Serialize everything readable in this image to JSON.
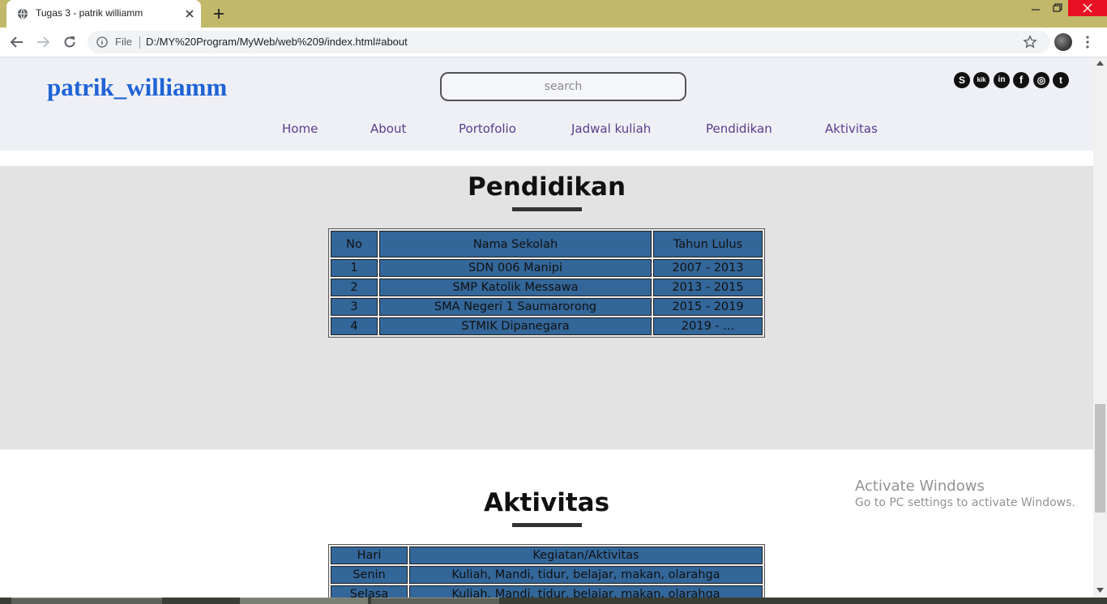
{
  "browser": {
    "tab_title": "Tugas 3 - patrik williamm",
    "file_label": "File",
    "url": "D:/MY%20Program/MyWeb/web%209/index.html#about",
    "chrome_color": "#c2b86a"
  },
  "site": {
    "logo": "patrik_williamm",
    "logo_color": "#1f63d6",
    "search_placeholder": "search",
    "nav": [
      "Home",
      "About",
      "Portofolio",
      "Jadwal kuliah",
      "Pendidikan",
      "Aktivitas"
    ],
    "social_icons": [
      "skype-icon",
      "kik-icon",
      "linkedin-icon",
      "facebook-icon",
      "instagram-icon",
      "tumblr-icon"
    ],
    "social_glyphs": [
      "S",
      "kik",
      "in",
      "f",
      "◎",
      "t"
    ]
  },
  "pendidikan": {
    "title": "Pendidikan",
    "headers": [
      "No",
      "Nama Sekolah",
      "Tahun Lulus"
    ],
    "rows": [
      [
        "1",
        "SDN 006 Manipi",
        "2007 - 2013"
      ],
      [
        "2",
        "SMP Katolik Messawa",
        "2013 - 2015"
      ],
      [
        "3",
        "SMA Negeri 1 Saumarorong",
        "2015 - 2019"
      ],
      [
        "4",
        "STMIK Dipanegara",
        "2019 - ..."
      ]
    ],
    "cell_color": "#336699"
  },
  "aktivitas": {
    "title": "Aktivitas",
    "headers": [
      "Hari",
      "Kegiatan/Aktivitas"
    ],
    "rows": [
      [
        "Senin",
        "Kuliah, Mandi, tidur, belajar, makan, olarahga"
      ],
      [
        "Selasa",
        "Kuliah, Mandi, tidur, belajar, makan, olarahga"
      ]
    ]
  },
  "watermark": {
    "title": "Activate Windows",
    "subtitle": "Go to PC settings to activate Windows."
  }
}
